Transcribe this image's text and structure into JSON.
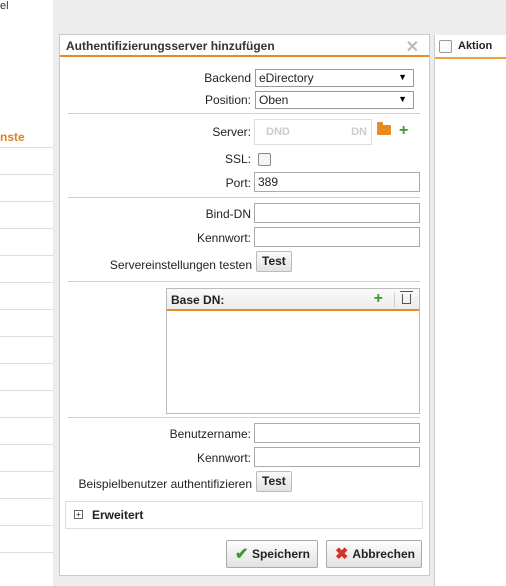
{
  "background": {
    "top_fragment": "el",
    "section_fragment": "nste",
    "right_header": "Aktion"
  },
  "dialog": {
    "title": "Authentifizierungsserver hinzufügen",
    "close_symbol": "✕",
    "backend_label": "Backend",
    "backend_value": "eDirectory",
    "position_label": "Position:",
    "position_value": "Oben",
    "server_label": "Server:",
    "server_placeholder_left": "DND",
    "server_placeholder_right": "DN",
    "ssl_label": "SSL:",
    "ssl_checked": false,
    "port_label": "Port:",
    "port_value": "389",
    "bind_dn_label": "Bind-DN",
    "bind_dn_value": "",
    "password_label": "Kennwort:",
    "password_value": "",
    "test_server_label": "Servereinstellungen testen",
    "test_button": "Test",
    "base_dn_label": "Base DN:",
    "username_label": "Benutzername:",
    "username_value": "",
    "password2_label": "Kennwort:",
    "password2_value": "",
    "test_user_label": "Beispielbenutzer authentifizieren",
    "test_button2": "Test",
    "advanced_label": "Erweitert",
    "save_button": "Speichern",
    "cancel_button": "Abbrechen"
  },
  "colors": {
    "accent": "#e98a1e",
    "add_green": "#3a9a2a",
    "cancel_red": "#d0342c"
  }
}
